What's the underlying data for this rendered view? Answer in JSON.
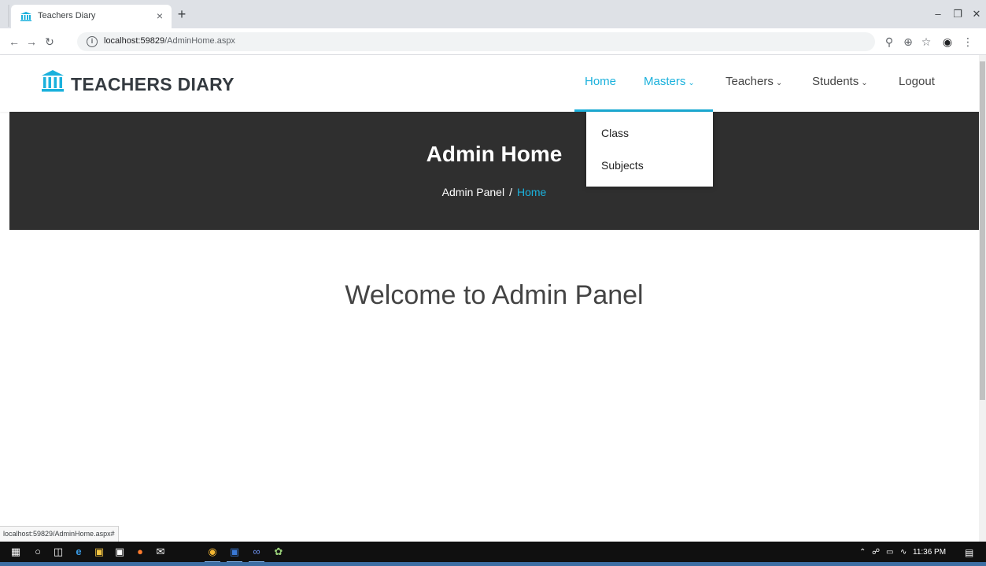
{
  "browser": {
    "tab_title": "Teachers Diary",
    "tab_close": "×",
    "new_tab": "+",
    "url_host": "localhost:59829",
    "url_path": "/AdminHome.aspx",
    "status_url": "localhost:59829/AdminHome.aspx#"
  },
  "site": {
    "brand": "TEACHERS DIARY",
    "accent_color": "#1bb1dc",
    "nav": [
      {
        "label": "Home",
        "active": true,
        "dropdown": false
      },
      {
        "label": "Masters",
        "active": false,
        "dropdown": true
      },
      {
        "label": "Teachers",
        "active": false,
        "dropdown": true
      },
      {
        "label": "Students",
        "active": false,
        "dropdown": true
      },
      {
        "label": "Logout",
        "active": false,
        "dropdown": false
      }
    ],
    "masters_menu": [
      "Class",
      "Subjects"
    ]
  },
  "hero": {
    "title": "Admin Home",
    "breadcrumb": {
      "root": "Admin Panel",
      "separator": "/",
      "current": "Home"
    }
  },
  "main": {
    "welcome": "Welcome to Admin Panel"
  },
  "taskbar": {
    "clock": "11:36 PM"
  }
}
